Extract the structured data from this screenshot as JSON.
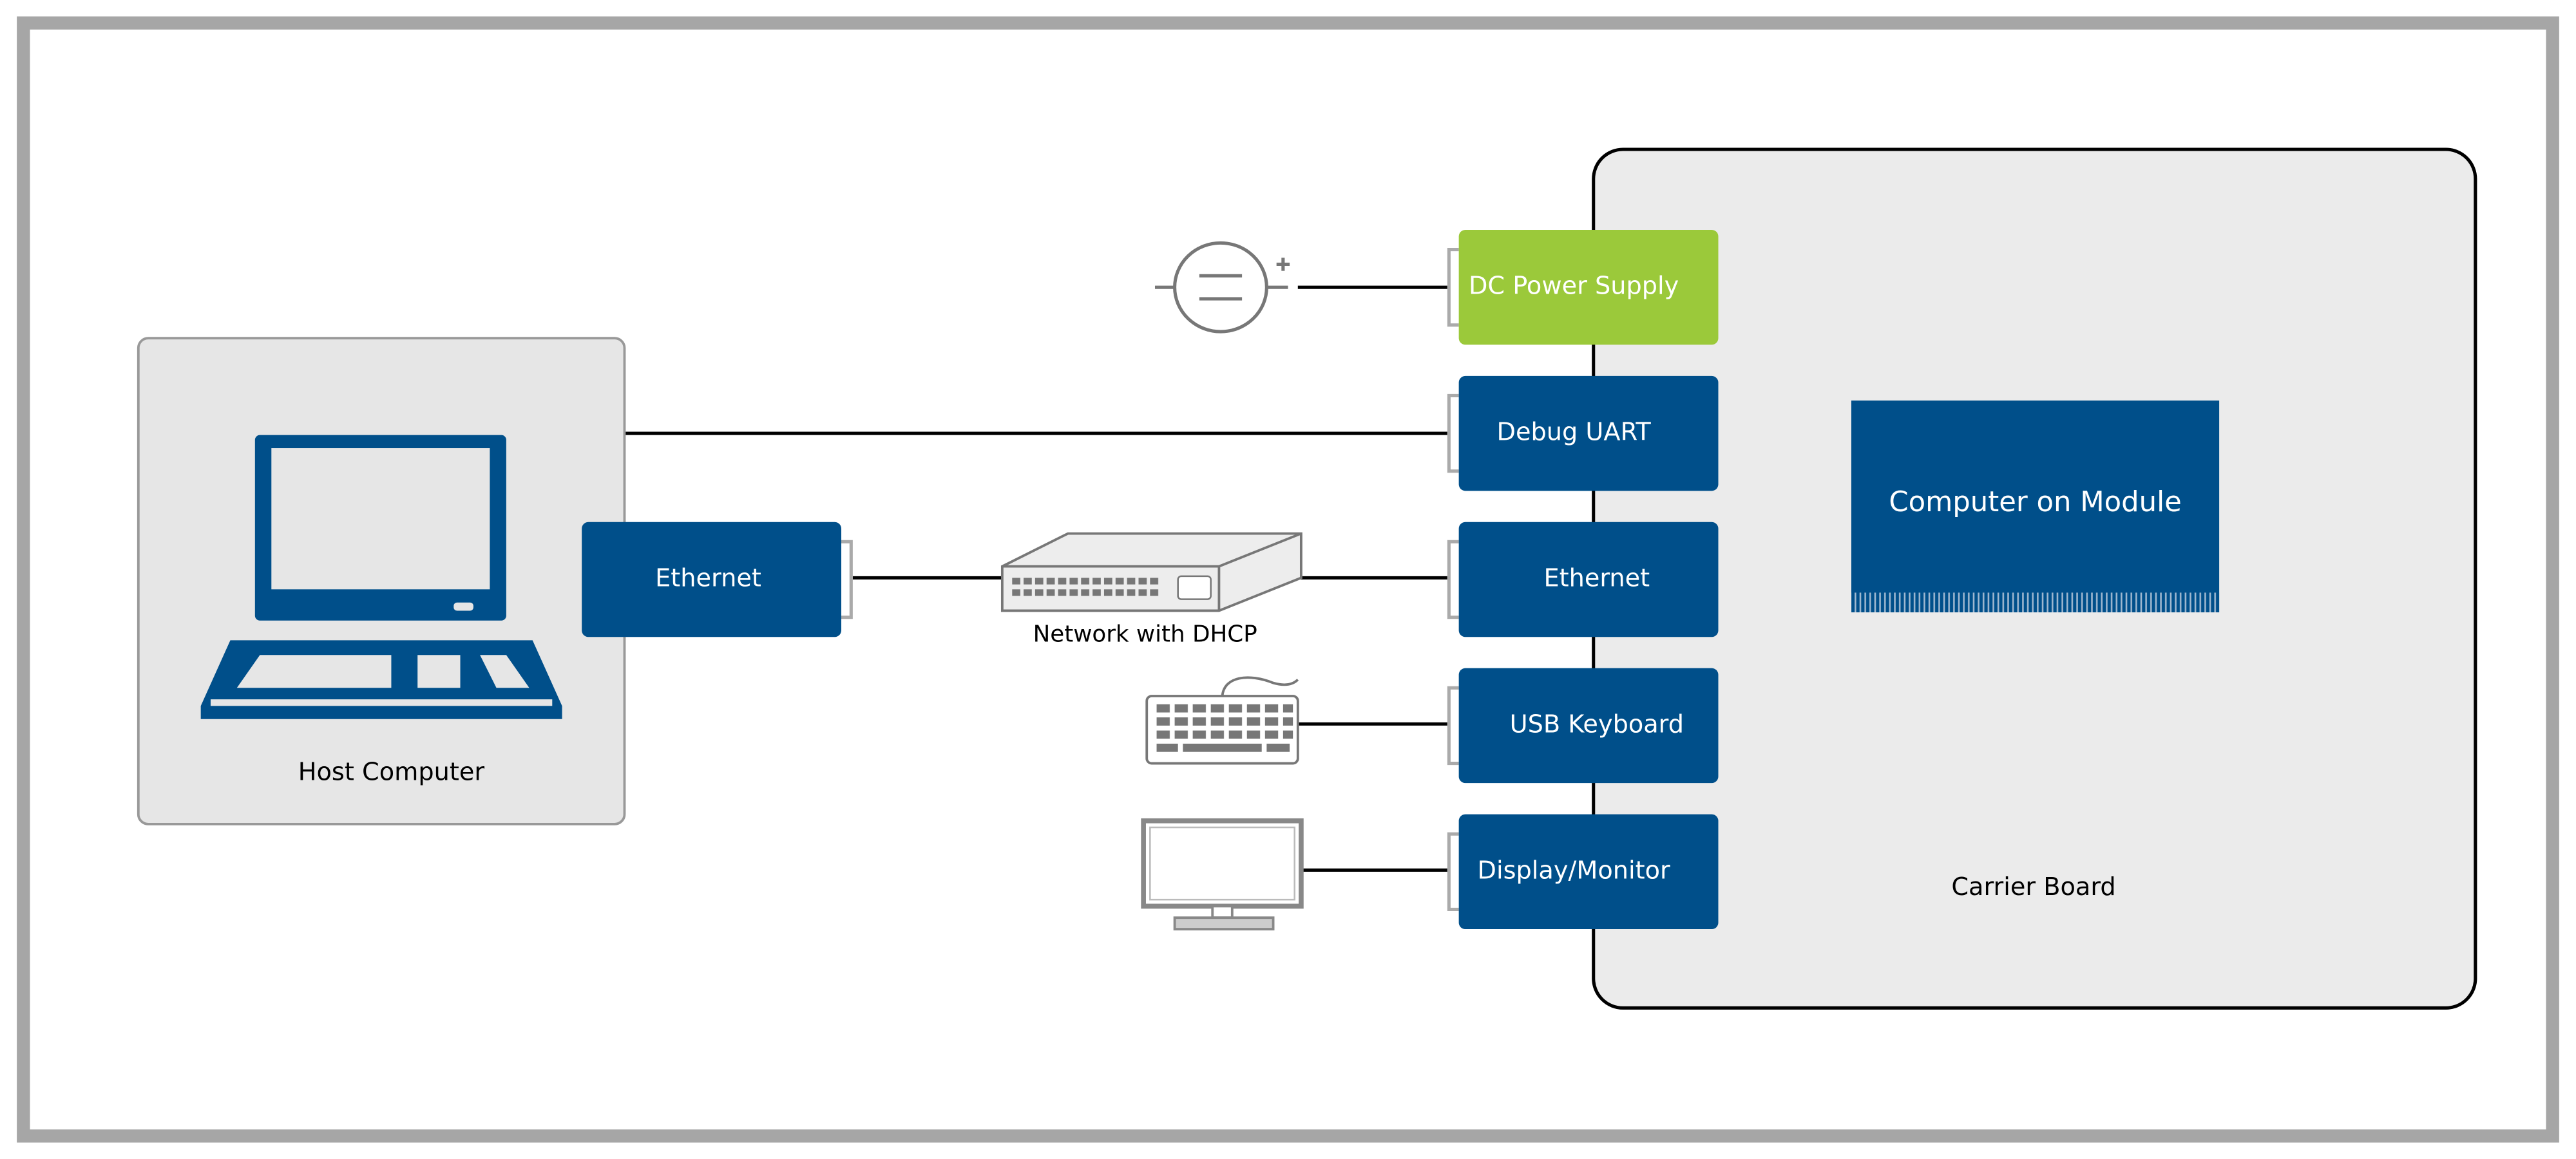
{
  "colors": {
    "module_blue": "#004f8a",
    "power_green": "#9bc93a",
    "board_fill": "#ebebeb",
    "frame_gray": "#a6a6a6",
    "icon_gray": "#777777"
  },
  "host": {
    "label": "Host Computer",
    "ethernet_label": "Ethernet",
    "icon": "laptop-icon"
  },
  "network": {
    "label": "Network with DHCP",
    "icon": "network-switch-icon"
  },
  "peripherals": {
    "power_icon": "dc-source-icon",
    "keyboard_icon": "keyboard-icon",
    "monitor_icon": "monitor-icon"
  },
  "carrier": {
    "label": "Carrier Board",
    "module_label": "Computer on Module",
    "ports": [
      {
        "label": "DC Power Supply"
      },
      {
        "label": "Debug UART"
      },
      {
        "label": "Ethernet"
      },
      {
        "label": "USB Keyboard"
      },
      {
        "label": "Display/Monitor"
      }
    ]
  }
}
